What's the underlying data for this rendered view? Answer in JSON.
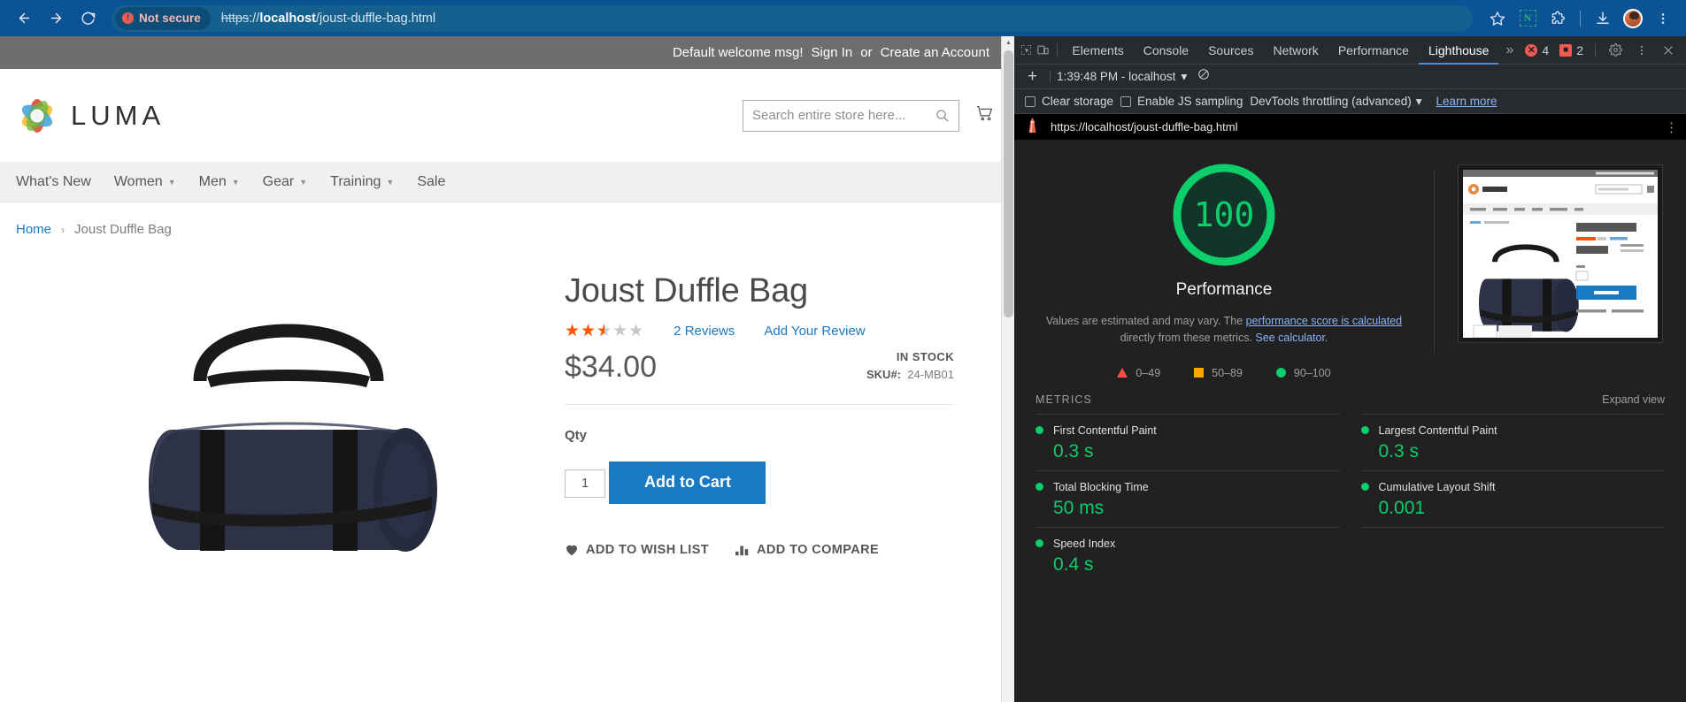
{
  "browser": {
    "back_icon": "back-arrow-icon",
    "forward_icon": "forward-arrow-icon",
    "reload_icon": "reload-icon",
    "security_label": "Not secure",
    "url_scheme": "https",
    "url_sep": "://",
    "url_host": "localhost",
    "url_path": "/joust-duffle-bag.html",
    "full_url": "https://localhost/joust-duffle-bag.html",
    "bookmark_icon": "star-icon",
    "extension_letter": "N",
    "extensions_icon": "puzzle-icon",
    "download_icon": "download-icon",
    "profile_icon": "avatar-icon",
    "menu_icon": "kebab-menu-icon"
  },
  "store": {
    "topbar": {
      "welcome": "Default welcome msg!",
      "sign_in": "Sign In",
      "or": "or",
      "create_account": "Create an Account"
    },
    "brand": "LUMA",
    "search": {
      "placeholder": "Search entire store here...",
      "value": "",
      "icon": "search-icon"
    },
    "cart_icon": "cart-icon",
    "nav": [
      {
        "label": "What's New",
        "has_caret": false
      },
      {
        "label": "Women",
        "has_caret": true
      },
      {
        "label": "Men",
        "has_caret": true
      },
      {
        "label": "Gear",
        "has_caret": true
      },
      {
        "label": "Training",
        "has_caret": true
      },
      {
        "label": "Sale",
        "has_caret": false
      }
    ],
    "breadcrumb": {
      "home": "Home",
      "separator": "›",
      "current": "Joust Duffle Bag"
    },
    "product": {
      "title": "Joust Duffle Bag",
      "rating_percent": 50,
      "reviews_count": "2",
      "reviews_label": "Reviews",
      "add_review": "Add Your Review",
      "price": "$34.00",
      "stock_status": "IN STOCK",
      "sku_label": "SKU#:",
      "sku_value": "24-MB01",
      "qty_label": "Qty",
      "qty_value": "1",
      "add_to_cart": "Add to Cart",
      "wishlist": "ADD TO WISH LIST",
      "compare": "ADD TO COMPARE",
      "wishlist_icon": "heart-icon",
      "compare_icon": "bar-chart-icon"
    }
  },
  "devtools": {
    "inspect_icon": "inspect-element-icon",
    "device_icon": "device-toolbar-icon",
    "tabs": [
      {
        "label": "Elements",
        "active": false
      },
      {
        "label": "Console",
        "active": false
      },
      {
        "label": "Sources",
        "active": false
      },
      {
        "label": "Network",
        "active": false
      },
      {
        "label": "Performance",
        "active": false
      },
      {
        "label": "Lighthouse",
        "active": true
      }
    ],
    "more_tabs": "»",
    "error_count": "4",
    "warning_count": "2",
    "settings_icon": "gear-icon",
    "menu_icon": "kebab-menu-icon",
    "close_icon": "close-icon",
    "toolbar": {
      "new_report_icon": "plus-icon",
      "report_selector": "1:39:48 PM - localhost",
      "selector_caret": "▾",
      "clear_icon": "clear-icon"
    },
    "options": {
      "clear_storage": "Clear storage",
      "js_sampling": "Enable JS sampling",
      "throttling": "DevTools throttling (advanced)",
      "throttling_caret": "▾",
      "learn_more": "Learn more"
    }
  },
  "lighthouse": {
    "icon": "lighthouse-icon",
    "url": "https://localhost/joust-duffle-bag.html",
    "kebab_icon": "kebab-menu-icon",
    "score": "100",
    "category": "Performance",
    "description_part1": "Values are estimated and may vary. The ",
    "description_link1": "performance score is calculated",
    "description_part2": " directly from these metrics. ",
    "description_link2": "See calculator.",
    "legend": [
      {
        "shape": "triangle",
        "range": "0–49",
        "color": "#ff4e42"
      },
      {
        "shape": "square",
        "range": "50–89",
        "color": "#ffa400"
      },
      {
        "shape": "circle",
        "range": "90–100",
        "color": "#0cce6b"
      }
    ],
    "metrics_heading": "METRICS",
    "expand_view": "Expand view",
    "metrics": [
      {
        "name": "First Contentful Paint",
        "value": "0.3 s",
        "status": "pass"
      },
      {
        "name": "Largest Contentful Paint",
        "value": "0.3 s",
        "status": "pass"
      },
      {
        "name": "Total Blocking Time",
        "value": "50 ms",
        "status": "pass"
      },
      {
        "name": "Cumulative Layout Shift",
        "value": "0.001",
        "status": "pass"
      },
      {
        "name": "Speed Index",
        "value": "0.4 s",
        "status": "pass"
      }
    ],
    "thumbnail_alt": "Joust Duffle Bag page screenshot"
  }
}
